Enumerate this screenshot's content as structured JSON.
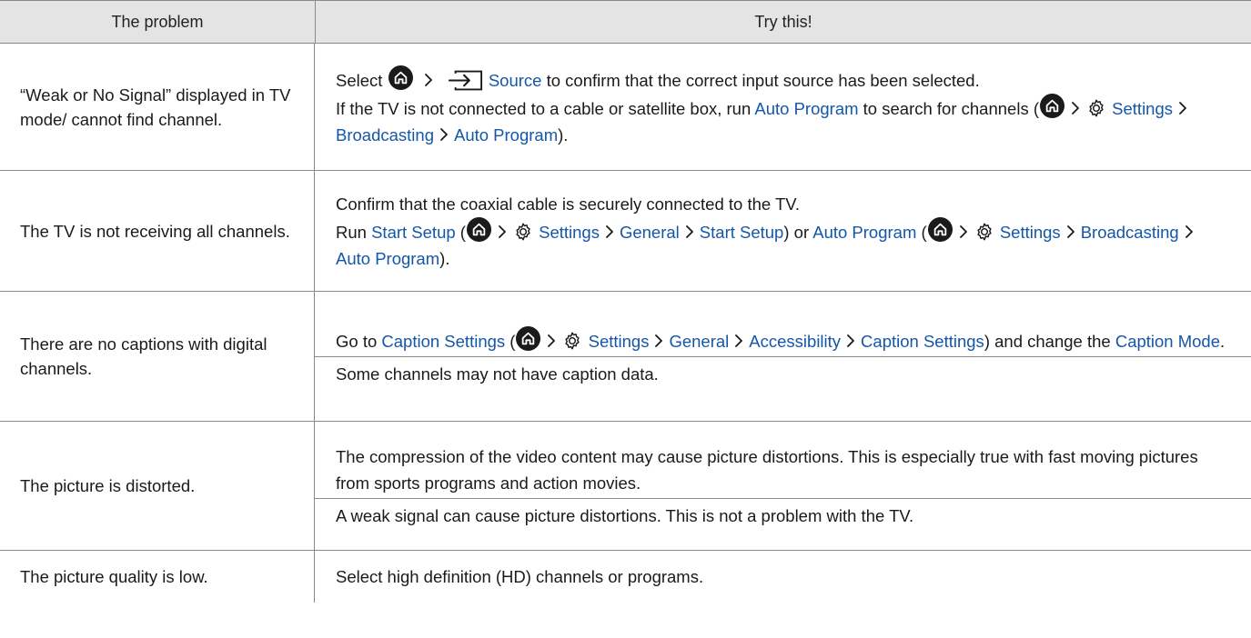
{
  "header": {
    "col1": "The problem",
    "col2": "Try this!"
  },
  "rows": [
    {
      "problem": "“Weak or No Signal” displayed in TV mode/ cannot find channel.",
      "p1": {
        "t1": "Select",
        "link1": "Source",
        "t2": "to confirm that the correct input source has been selected."
      },
      "p2": {
        "t1": "If the TV is not connected to a cable or satellite box, run",
        "link1": "Auto Program",
        "t2": "to search for channels",
        "open": "(",
        "link2": "Settings",
        "link3": "Broadcasting",
        "link4": "Auto Program",
        "close": ")."
      }
    },
    {
      "problem": "The TV is not receiving all channels.",
      "p1": {
        "t1": "Confirm that the coaxial cable is securely connected to the TV."
      },
      "p2": {
        "t1": "Run",
        "link1": "Start Setup",
        "open": "(",
        "link2": "Settings",
        "link3": "General",
        "link4": "Start Setup",
        "mid": ") or",
        "link5": "Auto Program",
        "open2": "(",
        "link6": "Settings",
        "link7": "Broadcasting",
        "link8": "Auto Program",
        "close": ")."
      }
    },
    {
      "problem": "There are no captions with digital channels.",
      "p1": {
        "t1": "Go to",
        "link1": "Caption Settings",
        "open": "(",
        "link2": "Settings",
        "link3": "General",
        "link4": "Accessibility",
        "link5": "Caption Settings",
        "close": ")",
        "t2": "and change the",
        "link6": "Caption Mode",
        "end": "."
      },
      "p2": {
        "t1": "Some channels may not have caption data."
      }
    },
    {
      "problem": "The picture is distorted.",
      "p1": {
        "t1": "The compression of the video content may cause picture distortions. This is especially true with fast moving pictures from sports programs and action movies."
      },
      "p2": {
        "t1": "A weak signal can cause picture distortions. This is not a problem with the TV."
      }
    },
    {
      "problem": "The picture quality is low.",
      "p1": {
        "t1": "Select high definition (HD) channels or programs."
      }
    }
  ]
}
